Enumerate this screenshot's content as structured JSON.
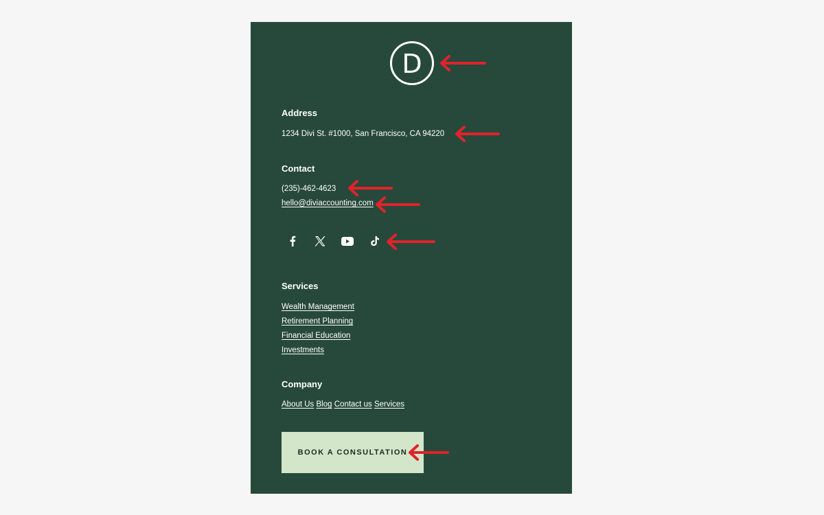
{
  "brand": {
    "logo_letter": "D"
  },
  "address": {
    "heading": "Address",
    "value": "1234 Divi St. #1000, San Francisco, CA 94220"
  },
  "contact": {
    "heading": "Contact",
    "phone": "(235)-462-4623",
    "email": "hello@diviaccounting.com"
  },
  "social": {
    "icons": [
      "facebook-icon",
      "x-twitter-icon",
      "youtube-icon",
      "tiktok-icon"
    ]
  },
  "services": {
    "heading": "Services",
    "links": [
      "Wealth Management",
      "Retirement Planning",
      "Financial Education",
      "Investments"
    ]
  },
  "company": {
    "heading": "Company",
    "links": [
      "About Us",
      "Blog",
      "Contact us",
      "Services"
    ]
  },
  "cta": {
    "label": "BOOK A CONSULTATION"
  },
  "colors": {
    "background": "#f6f6f6",
    "panel": "#27493b",
    "text": "#ffffff",
    "button": "#d3e6c9",
    "button_text": "#1b2b22",
    "annotation_arrow": "#e0232b"
  }
}
